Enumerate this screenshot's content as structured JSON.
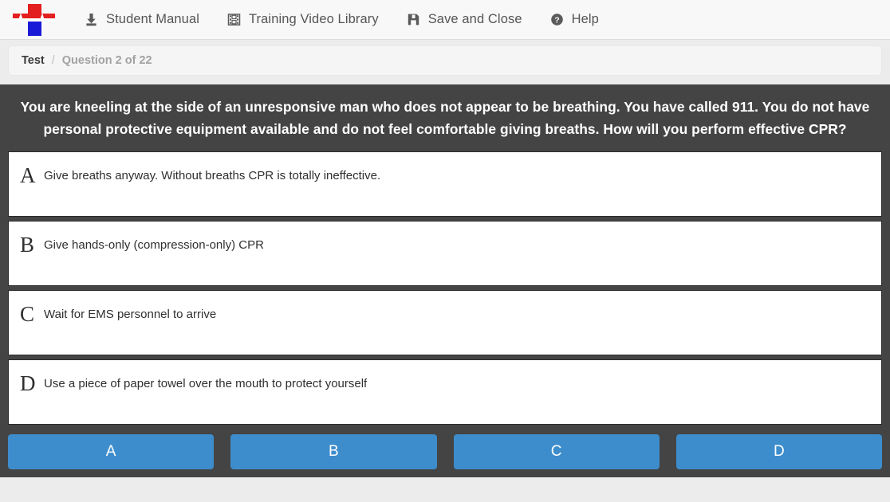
{
  "topnav": {
    "logo_alt": "medical-cross-ekg-logo",
    "items": [
      {
        "label": "Student Manual",
        "icon": "download-icon"
      },
      {
        "label": "Training Video Library",
        "icon": "film-icon"
      },
      {
        "label": "Save and Close",
        "icon": "save-icon"
      },
      {
        "label": "Help",
        "icon": "question-circle-icon"
      }
    ]
  },
  "breadcrumb": {
    "current": "Test",
    "separator": "/",
    "position": "Question 2 of 22"
  },
  "question": {
    "text": "You are kneeling at the side of an unresponsive man who does not appear to be breathing. You have called 911. You do not have personal protective equipment available and do not feel comfortable giving breaths. How will you perform effective CPR?"
  },
  "answers": [
    {
      "letter": "A",
      "text": "Give breaths anyway. Without breaths CPR is totally ineffective."
    },
    {
      "letter": "B",
      "text": "Give hands-only (compression-only) CPR"
    },
    {
      "letter": "C",
      "text": "Wait for EMS personnel to arrive"
    },
    {
      "letter": "D",
      "text": "Use a piece of paper towel over the mouth to protect yourself"
    }
  ],
  "choice_buttons": [
    {
      "label": "A"
    },
    {
      "label": "B"
    },
    {
      "label": "C"
    },
    {
      "label": "D"
    }
  ],
  "colors": {
    "panel_dark": "#444444",
    "button_blue": "#3d8dcc",
    "page_background": "#ececec",
    "topnav_background": "#f8f8f8",
    "logo_red": "#e41f1f",
    "logo_blue": "#1a19d8"
  }
}
